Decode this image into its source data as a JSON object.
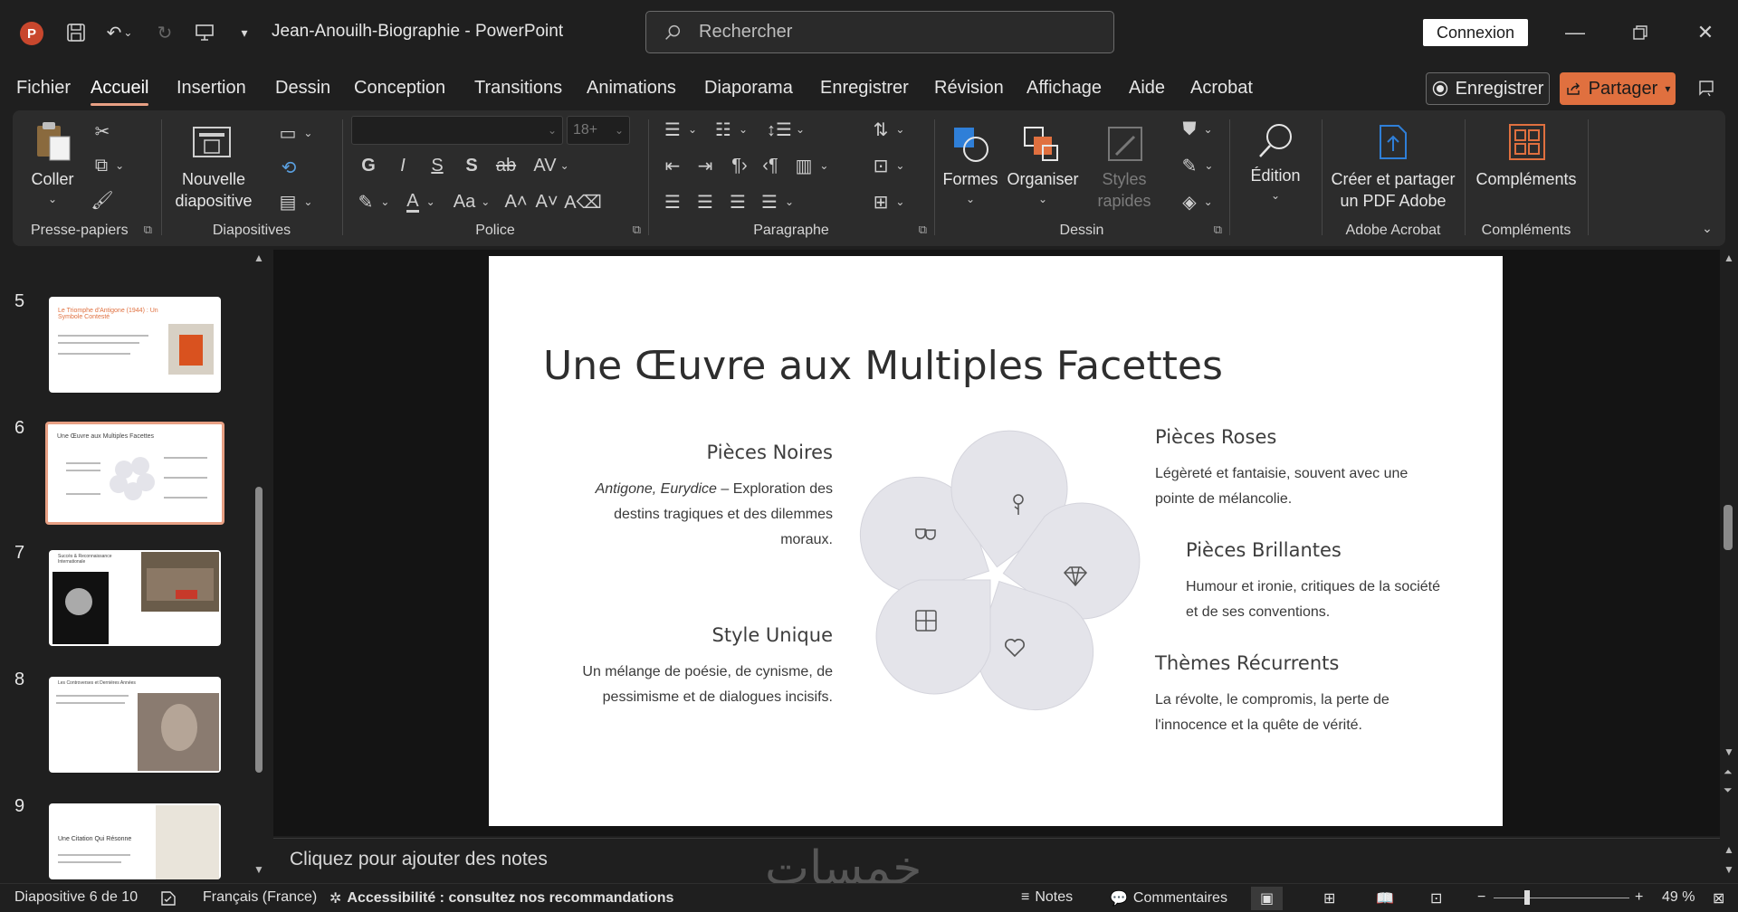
{
  "window": {
    "title": "Jean-Anouilh-Biographie  -  PowerPoint",
    "search_placeholder": "Rechercher",
    "connexion_label": "Connexion"
  },
  "menu": {
    "items": [
      "Fichier",
      "Accueil",
      "Insertion",
      "Dessin",
      "Conception",
      "Transitions",
      "Animations",
      "Diaporama",
      "Enregistrer",
      "Révision",
      "Affichage",
      "Aide",
      "Acrobat"
    ],
    "active": "Accueil",
    "record_label": "Enregistrer",
    "share_label": "Partager"
  },
  "ribbon": {
    "clipboard": {
      "paste_label": "Coller",
      "group_label": "Presse-papiers"
    },
    "slides": {
      "new_slide_label": "Nouvelle diapositive",
      "group_label": "Diapositives"
    },
    "font": {
      "font_name": "",
      "font_size": "18+",
      "group_label": "Police"
    },
    "paragraph": {
      "group_label": "Paragraphe"
    },
    "drawing": {
      "shapes_label": "Formes",
      "arrange_label": "Organiser",
      "quick_styles_label": "Styles rapides",
      "group_label": "Dessin"
    },
    "editing": {
      "label": "Édition"
    },
    "acrobat": {
      "label": "Créer et partager un PDF Adobe",
      "group_label": "Adobe Acrobat"
    },
    "addins": {
      "label": "Compléments",
      "group_label": "Compléments"
    }
  },
  "thumbnails": [
    {
      "num": "5",
      "title": "Le Triomphe d'Antigone (1944) : Un Symbole Contesté"
    },
    {
      "num": "6",
      "title": "Une Œuvre aux Multiples Facettes",
      "selected": true
    },
    {
      "num": "7",
      "title": "Succès & Reconnaissance Internationale"
    },
    {
      "num": "8",
      "title": "Les Controverses et Dernières Années"
    },
    {
      "num": "9",
      "title": "Une Citation Qui Résonne"
    }
  ],
  "slide": {
    "title": "Une Œuvre aux Multiples Facettes",
    "sections": {
      "noires": {
        "title": "Pièces Noires",
        "body_em": "Antigone, Eurydice",
        "body": " – Exploration des destins tragiques et des dilemmes moraux."
      },
      "style": {
        "title": "Style Unique",
        "body": "Un mélange de poésie, de cynisme, de pessimisme et de dialogues incisifs."
      },
      "roses": {
        "title": "Pièces Roses",
        "body": "Légèreté et fantaisie, souvent avec une pointe de mélancolie."
      },
      "brillantes": {
        "title": "Pièces Brillantes",
        "body": "Humour et ironie, critiques de la société et de ses conventions."
      },
      "themes": {
        "title": "Thèmes Récurrents",
        "body": "La révolte, le compromis, la perte de l'innocence et la quête de vérité."
      }
    }
  },
  "notes_placeholder": "Cliquez pour ajouter des notes",
  "status": {
    "slide_info": "Diapositive 6 de 10",
    "language": "Français (France)",
    "accessibility": "Accessibilité : consultez nos recommandations",
    "notes_label": "Notes",
    "comments_label": "Commentaires",
    "zoom": "49 %"
  },
  "watermark_text": "خمسات",
  "colors": {
    "accent": "#e0703f",
    "selection": "#e8a084",
    "petal": "#e4e4ea"
  }
}
